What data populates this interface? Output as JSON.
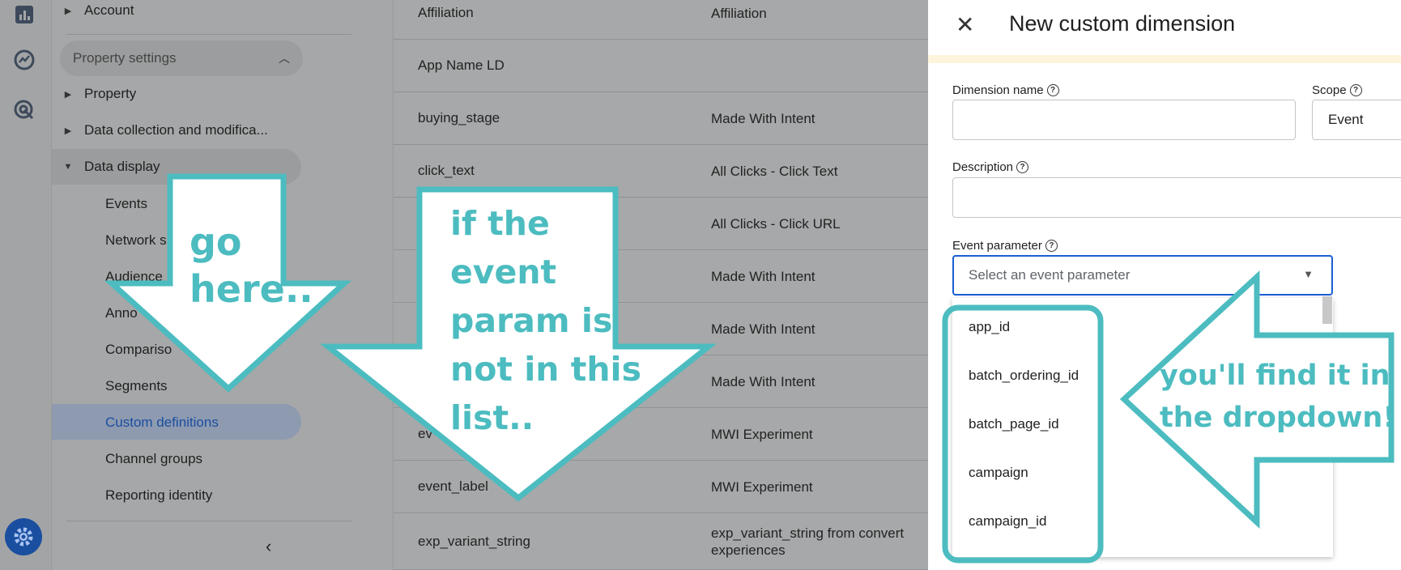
{
  "nav": {
    "account": "Account",
    "section": "Property settings",
    "property": "Property",
    "data_collection": "Data collection and modifica...",
    "data_display": "Data display",
    "sub_items": [
      {
        "label": "Events"
      },
      {
        "label": "Network s"
      },
      {
        "label": "Audience"
      },
      {
        "label": "Anno"
      },
      {
        "label": "Compariso"
      },
      {
        "label": "Segments"
      },
      {
        "label": "Custom definitions"
      },
      {
        "label": "Channel groups"
      },
      {
        "label": "Reporting identity"
      }
    ]
  },
  "table": {
    "rows": [
      {
        "name": "Affiliation",
        "desc": "Affiliation"
      },
      {
        "name": "App Name LD",
        "desc": ""
      },
      {
        "name": "buying_stage",
        "desc": "Made With Intent"
      },
      {
        "name": "click_text",
        "desc": "All Clicks - Click Text"
      },
      {
        "name": "",
        "desc": "All Clicks - Click URL"
      },
      {
        "name": "",
        "desc": "Made With Intent"
      },
      {
        "name": "",
        "desc": "Made With Intent"
      },
      {
        "name": "",
        "desc": "Made With Intent"
      },
      {
        "name": "ev",
        "desc": "MWI Experiment"
      },
      {
        "name": "event_label",
        "desc": "MWI Experiment"
      },
      {
        "name": "exp_variant_string",
        "desc": "exp_variant_string from convert experiences"
      }
    ]
  },
  "panel": {
    "title": "New custom dimension",
    "dimension_name_label": "Dimension name",
    "scope_label": "Scope",
    "scope_value": "Event",
    "description_label": "Description",
    "event_parameter_label": "Event parameter",
    "event_parameter_placeholder": "Select an event parameter",
    "options": [
      "app_id",
      "batch_ordering_id",
      "batch_page_id",
      "campaign",
      "campaign_id"
    ]
  },
  "annotations": {
    "go_here": [
      "go",
      "here.."
    ],
    "not_in_list": [
      "if the",
      "event",
      "param is",
      "not in this",
      "list.."
    ],
    "find_it": [
      "you'll find it in",
      "the dropdown!"
    ]
  },
  "colors": {
    "annotation": "#4cbcc0",
    "accent_blue": "#1a5fd4",
    "active_nav_text": "#1a4fa0"
  }
}
